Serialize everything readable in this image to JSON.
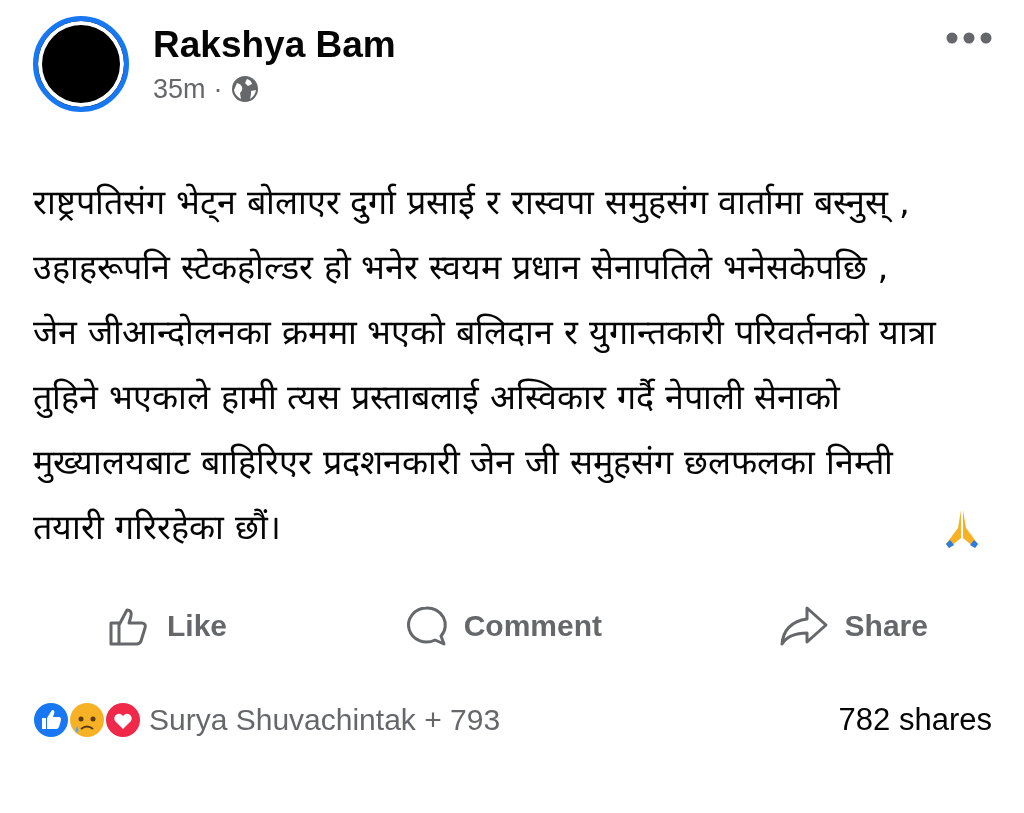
{
  "post": {
    "author": "Rakshya Bam",
    "time": "35m",
    "separator": "·",
    "body": "राष्ट्रपतिसंग भेट्न बोलाएर दुर्गा प्रसाई र रास्वपा समुहसंग वार्तामा बस्नुस् , उहाहरूपनि स्टेकहोल्डर हो भनेर स्वयम प्रधान सेनापतिले भनेसकेपछि , जेन जीआन्दोलनका क्रममा भएको बलिदान र युगान्तकारी परिवर्तनको यात्रा तुहिने भएकाले हामी त्यस प्रस्ताबलाई अस्विकार गर्दै नेपाली सेनाको मुख्यालयबाट बाहिरिएर प्रदशनकारी जेन जी समुहसंग छलफलका निम्ती तयारी गरिरहेका छौं।"
  },
  "actions": [
    {
      "kind": "like",
      "label": "Like"
    },
    {
      "kind": "comment",
      "label": "Comment"
    },
    {
      "kind": "share",
      "label": "Share"
    }
  ],
  "reactions": {
    "icons": [
      {
        "kind": "like"
      },
      {
        "kind": "sad"
      },
      {
        "kind": "love"
      }
    ],
    "summary": "Surya Shuvachintak + 793",
    "shares": "782 shares"
  }
}
